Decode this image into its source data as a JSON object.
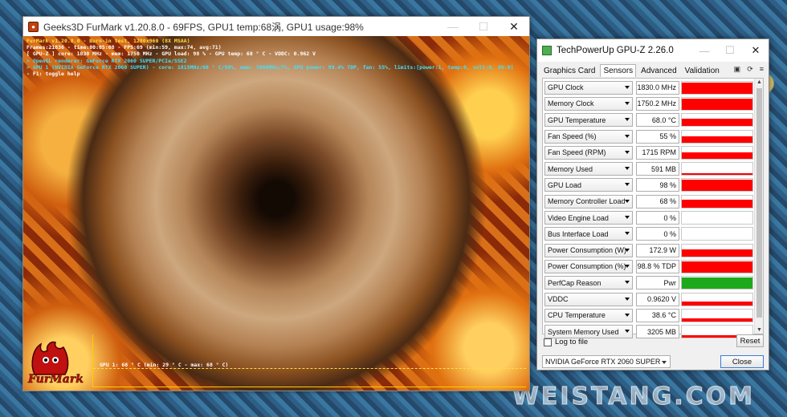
{
  "desktop": {
    "watermark": "WEISTANG.COM"
  },
  "furmark": {
    "title": "Geeks3D FurMark v1.20.8.0 - 69FPS, GPU1 temp:68涡, GPU1 usage:98%",
    "overlay": [
      "FurMark v1.20.8.0 - Burn-in test, 1280x960 (8X MSAA)",
      "Frames:21836 - time:00:05:08 - FPS:69 (min:59, max:74, avg:71)",
      "[ GPU-Z ] core: 1830 MHz - mem: 1750 MHz - GPU load: 98 % - GPU temp: 68 ° C - VDDC: 0.962 V",
      "> OpenGL renderer: GeForce RTX 2060 SUPER/PCIe/SSE2",
      "> GPU 1 (NVIDIA GeForce RTX 2060 SUPER) - core: 1815MHz/68 ° C/98%, mem: 7000MHz/7%, GPU power: 99.4% TDP, fan: 55%, limits:[power:1, temp:0, volt:0, OV:0]",
      "- F1: toggle help"
    ],
    "graph_label": "GPU 1: 68 ° C (min: 29 ° C - max: 68 ° C)",
    "logo_text": "FurMark"
  },
  "gpuz": {
    "title": "TechPowerUp GPU-Z 2.26.0",
    "tabs": [
      "Graphics Card",
      "Sensors",
      "Advanced",
      "Validation"
    ],
    "active_tab": "Sensors",
    "sensors": [
      {
        "name": "GPU Clock",
        "value": "1830.0 MHz",
        "level": 0.9,
        "color": "#ff0000"
      },
      {
        "name": "Memory Clock",
        "value": "1750.2 MHz",
        "level": 0.9,
        "color": "#ff0000"
      },
      {
        "name": "GPU Temperature",
        "value": "68.0 °C",
        "level": 0.55,
        "color": "#ff0000"
      },
      {
        "name": "Fan Speed (%)",
        "value": "55 %",
        "level": 0.5,
        "color": "#ff0000"
      },
      {
        "name": "Fan Speed (RPM)",
        "value": "1715 RPM",
        "level": 0.5,
        "color": "#ff0000"
      },
      {
        "name": "Memory Used",
        "value": "591 MB",
        "level": 0.12,
        "color": "#ff0000"
      },
      {
        "name": "GPU Load",
        "value": "98 %",
        "level": 0.9,
        "color": "#ff0000"
      },
      {
        "name": "Memory Controller Load",
        "value": "68 %",
        "level": 0.65,
        "color": "#ff0000"
      },
      {
        "name": "Video Engine Load",
        "value": "0 %",
        "level": 0,
        "color": "#ff0000"
      },
      {
        "name": "Bus Interface Load",
        "value": "0 %",
        "level": 0,
        "color": "#ff0000"
      },
      {
        "name": "Power Consumption (W)",
        "value": "172.9 W",
        "level": 0.55,
        "color": "#ff0000"
      },
      {
        "name": "Power Consumption (%)",
        "value": "98.8 % TDP",
        "level": 0.9,
        "color": "#ff0000"
      },
      {
        "name": "PerfCap Reason",
        "value": "Pwr",
        "level": 0.9,
        "color": "#1caa1c"
      },
      {
        "name": "VDDC",
        "value": "0.9620 V",
        "level": 0.3,
        "color": "#ff0000"
      },
      {
        "name": "CPU Temperature",
        "value": "38.6 °C",
        "level": 0.25,
        "color": "#ff0000"
      },
      {
        "name": "System Memory Used",
        "value": "3205 MB",
        "level": 0.2,
        "color": "#ff0000"
      }
    ],
    "log_label": "Log to file",
    "reset_label": "Reset",
    "gpu_select": "NVIDIA GeForce RTX 2060 SUPER",
    "close_label": "Close"
  }
}
